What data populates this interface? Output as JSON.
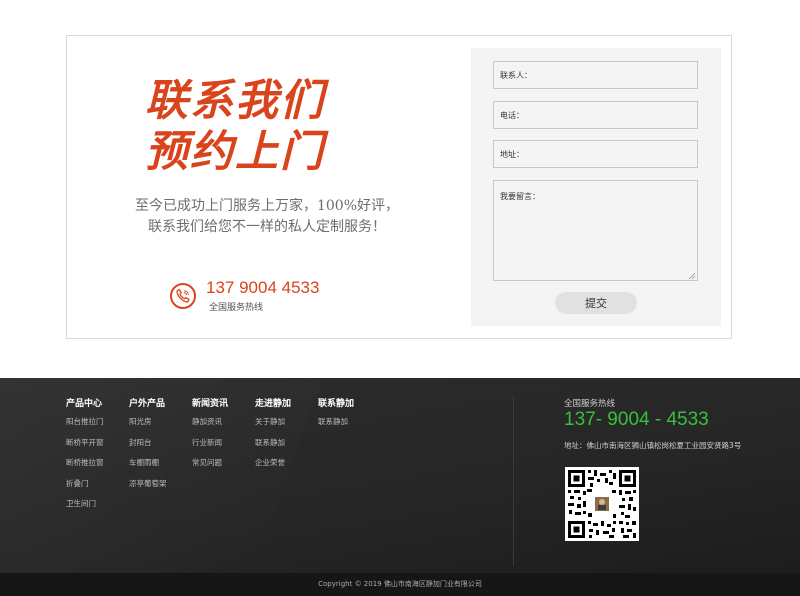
{
  "contact": {
    "headline_line1": "联系我们",
    "headline_line2": "预约上门",
    "desc_line1": "至今已成功上门服务上万家，100%好评，",
    "desc_line2": "联系我们给您不一样的私人定制服务！",
    "phone_number": "137 9004 4533",
    "phone_caption": "全国服务热线",
    "icon": "phone-icon",
    "accent_color": "#d9441c"
  },
  "form": {
    "name_placeholder": "联系人：",
    "tel_placeholder": "电话：",
    "addr_placeholder": "地址：",
    "message_placeholder": "我要留言：",
    "submit_label": "提交"
  },
  "footer": {
    "nav": [
      {
        "title": "产品中心",
        "links": [
          "阳台推拉门",
          "断桥平开窗",
          "断桥推拉窗",
          "折叠门",
          "卫生间门"
        ]
      },
      {
        "title": "户外产品",
        "links": [
          "阳光房",
          "封阳台",
          "车棚雨棚",
          "凉亭葡萄架"
        ]
      },
      {
        "title": "新闻资讯",
        "links": [
          "静加资讯",
          "行业新闻",
          "常见问题"
        ]
      },
      {
        "title": "走进静加",
        "links": [
          "关于静加",
          "联系静加",
          "企业荣誉"
        ]
      },
      {
        "title": "联系静加",
        "links": [
          "联系静加"
        ]
      }
    ],
    "hotline_label": "全国服务热线",
    "hotline_number": "137- 9004 - 4533",
    "hotline_color": "#36c13a",
    "address": "地址：佛山市南海区狮山镇松岗松夏工业园安贤路3号",
    "copyright": "Copyright © 2019 佛山市南海区静加门业有限公司"
  }
}
